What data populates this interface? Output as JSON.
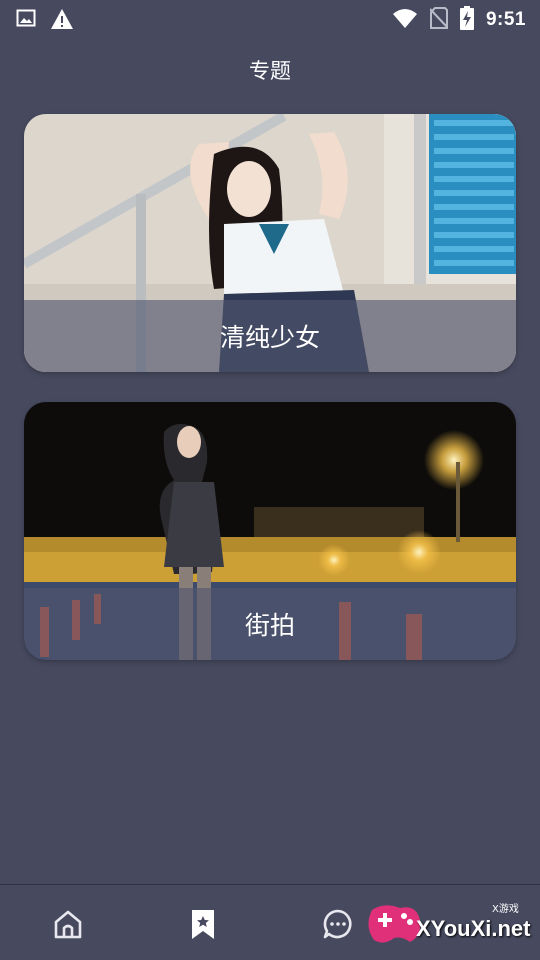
{
  "status_bar": {
    "time": "9:51",
    "icons": [
      "image-icon",
      "warning-icon",
      "wifi-icon",
      "no-sim-icon",
      "battery-charging-icon"
    ]
  },
  "header": {
    "title": "专题"
  },
  "topics": [
    {
      "label": "清纯少女",
      "image": "girl-in-school-uniform-photo"
    },
    {
      "label": "街拍",
      "image": "street-photo-at-night"
    }
  ],
  "bottom_nav": {
    "items": [
      {
        "icon": "home-icon",
        "active": false
      },
      {
        "icon": "bookmark-star-icon",
        "active": true
      },
      {
        "icon": "chat-icon",
        "active": false
      }
    ]
  },
  "watermark": {
    "text": "XYouXi.net",
    "small_text": "X游戏"
  },
  "colors": {
    "background": "#474a5f",
    "label_band": "#50566e",
    "icon": "#e8e8ee"
  }
}
